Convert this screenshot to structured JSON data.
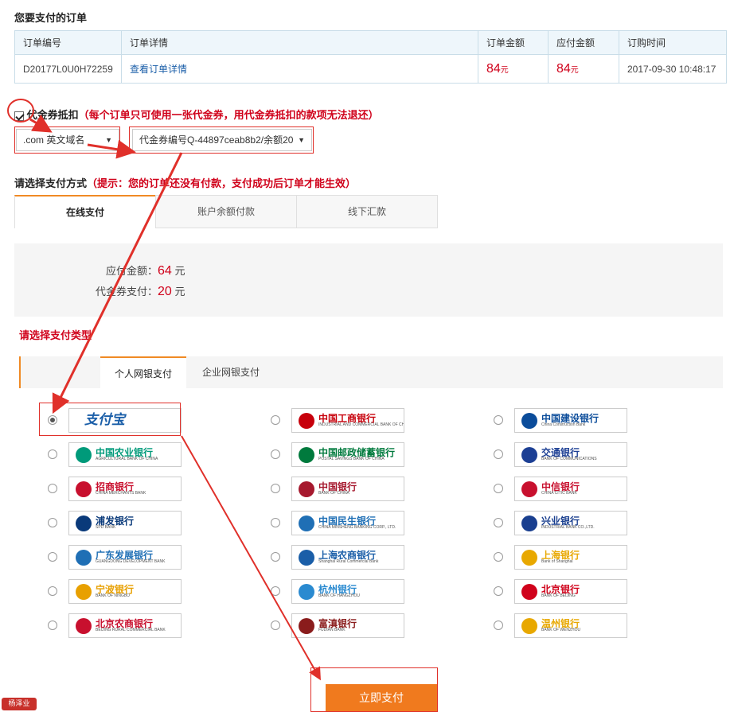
{
  "header": {
    "title": "您要支付的订单"
  },
  "order_table": {
    "columns": [
      "订单编号",
      "订单详情",
      "订单金额",
      "应付金额",
      "订购时间"
    ],
    "row": {
      "order_no": "D20177L0U0H72259",
      "detail_link": "查看订单详情",
      "order_amount": "84",
      "payable_amount": "84",
      "unit": "元",
      "time": "2017-09-30 10:48:17"
    }
  },
  "voucher": {
    "checked": true,
    "label": "代金券抵扣",
    "note": "（每个订单只可使用一张代金券，用代金券抵扣的款项无法退还）",
    "product_select": ".com 英文域名",
    "voucher_select": "代金券编号Q-44897ceab8b2/余额20"
  },
  "payment_method": {
    "title": "请选择支付方式",
    "hint": "（提示：您的订单还没有付款，支付成功后订单才能生效）",
    "tabs": [
      "在线支付",
      "账户余额付款",
      "线下汇款"
    ],
    "active_tab": 0
  },
  "summary": {
    "payable_label": "应付金额：",
    "payable_value": "64",
    "voucher_label": "代金券支付：",
    "voucher_value": "20",
    "unit": "元"
  },
  "pay_type": {
    "title": "请选择支付类型",
    "subtabs": [
      "个人网银支付",
      "企业网银支付"
    ],
    "active_subtab": 0
  },
  "banks": [
    {
      "cn": "支付宝",
      "en": "",
      "icon": "alipay-icon",
      "color": "#1a5ea8",
      "selected": true
    },
    {
      "cn": "中国工商银行",
      "en": "INDUSTRIAL AND COMMERCIAL BANK OF CHINA",
      "icon": "icbc-icon",
      "color": "#c7000b",
      "selected": false
    },
    {
      "cn": "中国建设银行",
      "en": "China Construction Bank",
      "icon": "ccb-icon",
      "color": "#0b4c9a",
      "selected": false
    },
    {
      "cn": "中国农业银行",
      "en": "AGRICULTURAL BANK OF CHINA",
      "icon": "abc-icon",
      "color": "#009a7a",
      "selected": false
    },
    {
      "cn": "中国邮政储蓄银行",
      "en": "POSTAL SAVINGS BANK OF CHINA",
      "icon": "psbc-icon",
      "color": "#007a3d",
      "selected": false
    },
    {
      "cn": "交通银行",
      "en": "BANK OF COMMUNICATIONS",
      "icon": "bocom-icon",
      "color": "#1c3f94",
      "selected": false
    },
    {
      "cn": "招商银行",
      "en": "CHINA MERCHANTS BANK",
      "icon": "cmb-icon",
      "color": "#c8102e",
      "selected": false
    },
    {
      "cn": "中国银行",
      "en": "BANK OF CHINA",
      "icon": "boc-icon",
      "color": "#a6192e",
      "selected": false
    },
    {
      "cn": "中信银行",
      "en": "CHINA CITIC BANK",
      "icon": "citic-icon",
      "color": "#c8102e",
      "selected": false
    },
    {
      "cn": "浦发银行",
      "en": "SPD BANK",
      "icon": "spdb-icon",
      "color": "#0a3a7a",
      "selected": false
    },
    {
      "cn": "中国民生银行",
      "en": "CHINA MINSHENG BANKING CORP., LTD.",
      "icon": "cmbc-icon",
      "color": "#1f6fb5",
      "selected": false
    },
    {
      "cn": "兴业银行",
      "en": "INDUSTRIAL BANK CO.,LTD.",
      "icon": "cib-icon",
      "color": "#1a3f8f",
      "selected": false
    },
    {
      "cn": "广东发展银行",
      "en": "GUANGDONG DEVELOPMENT BANK",
      "icon": "gdb-icon",
      "color": "#1f6fb5",
      "selected": false
    },
    {
      "cn": "上海农商银行",
      "en": "Shanghai Rural Commercial Bank",
      "icon": "srcb-icon",
      "color": "#1a5ea8",
      "selected": false
    },
    {
      "cn": "上海银行",
      "en": "Bank of Shanghai",
      "icon": "bosh-icon",
      "color": "#e8a800",
      "selected": false
    },
    {
      "cn": "宁波银行",
      "en": "BANK OF NINGBO",
      "icon": "nbcb-icon",
      "color": "#e8a000",
      "selected": false
    },
    {
      "cn": "杭州银行",
      "en": "BANK OF HANGZHOU",
      "icon": "hzb-icon",
      "color": "#2a8ad0",
      "selected": false
    },
    {
      "cn": "北京银行",
      "en": "BANK OF BEIJING",
      "icon": "bob-icon",
      "color": "#d0021b",
      "selected": false
    },
    {
      "cn": "北京农商银行",
      "en": "BEIJING RURAL COMMERCIAL BANK",
      "icon": "bjrcb-icon",
      "color": "#c8102e",
      "selected": false
    },
    {
      "cn": "富滇银行",
      "en": "FUDIAN BANK",
      "icon": "fudian-icon",
      "color": "#8a1c1c",
      "selected": false
    },
    {
      "cn": "温州银行",
      "en": "BANK OF WENZHOU",
      "icon": "wzb-icon",
      "color": "#e8a800",
      "selected": false
    }
  ],
  "submit": {
    "label": "立即支付"
  },
  "watermark": "杨泽业",
  "colors": {
    "accent": "#f08a24",
    "price": "#d0021b",
    "annotation": "#e0302a"
  }
}
